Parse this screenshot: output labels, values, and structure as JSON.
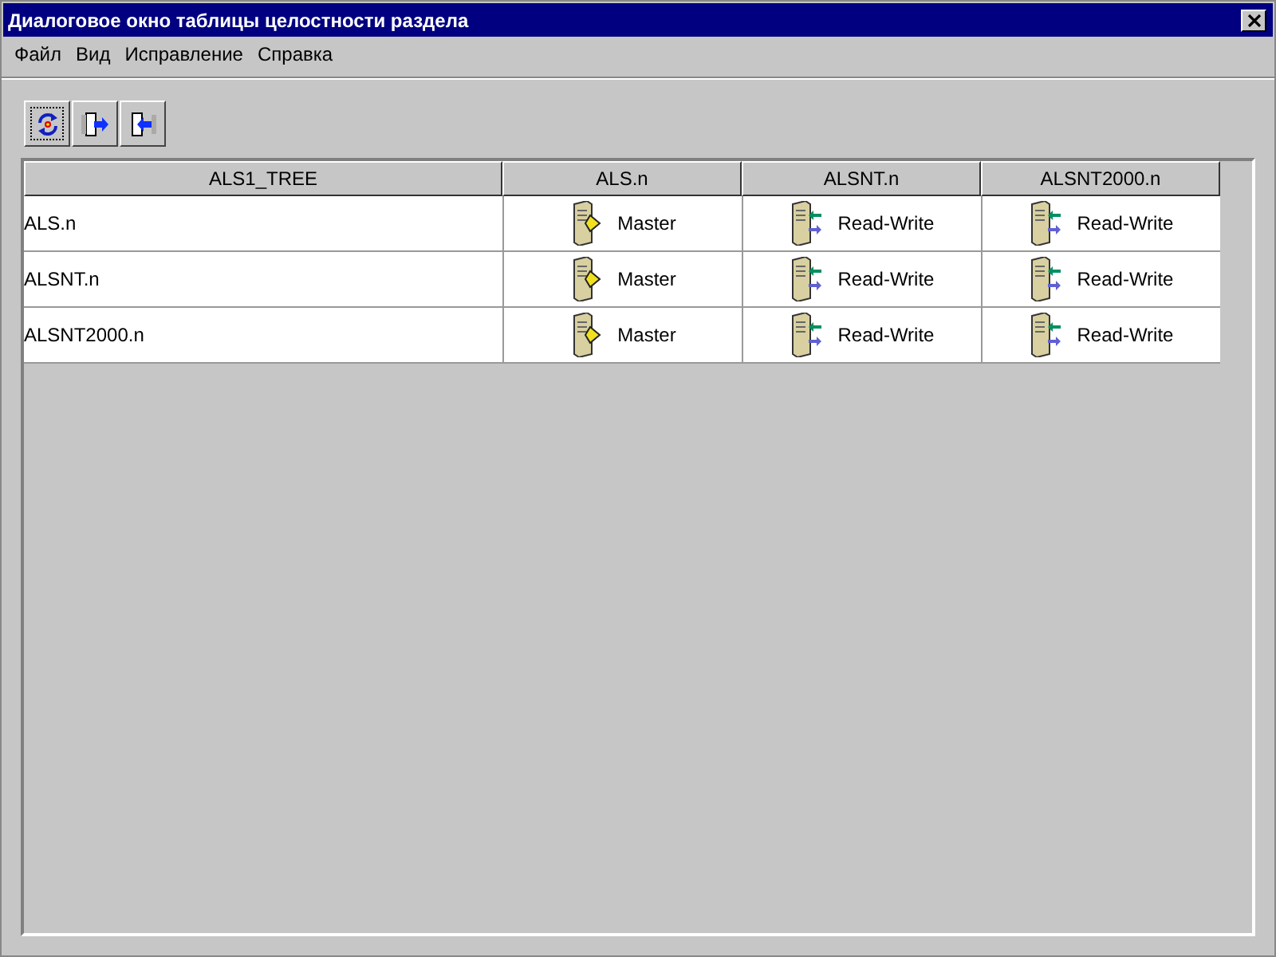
{
  "window": {
    "title": "Диалоговое окно таблицы целостности раздела"
  },
  "menu": [
    "Файл",
    "Вид",
    "Исправление",
    "Справка"
  ],
  "toolbar": [
    {
      "kind": "refresh",
      "selected": true
    },
    {
      "kind": "export",
      "selected": false
    },
    {
      "kind": "import",
      "selected": false
    }
  ],
  "table": {
    "row_header_title": "ALS1_TREE",
    "columns": [
      "ALS.n",
      "ALSNT.n",
      "ALSNT2000.n"
    ],
    "rows": [
      {
        "name": "ALS.n",
        "cells": [
          {
            "kind": "master",
            "text": "Master"
          },
          {
            "kind": "read-write",
            "text": "Read-Write"
          },
          {
            "kind": "read-write",
            "text": "Read-Write"
          }
        ]
      },
      {
        "name": "ALSNT.n",
        "cells": [
          {
            "kind": "master",
            "text": "Master"
          },
          {
            "kind": "read-write",
            "text": "Read-Write"
          },
          {
            "kind": "read-write",
            "text": "Read-Write"
          }
        ]
      },
      {
        "name": "ALSNT2000.n",
        "cells": [
          {
            "kind": "master",
            "text": "Master"
          },
          {
            "kind": "read-write",
            "text": "Read-Write"
          },
          {
            "kind": "read-write",
            "text": "Read-Write"
          }
        ]
      }
    ]
  }
}
